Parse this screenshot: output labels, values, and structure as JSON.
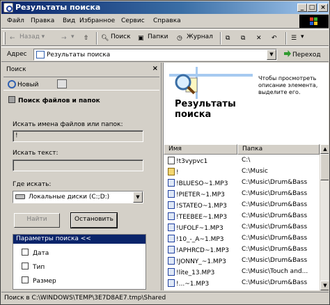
{
  "window": {
    "title": "Результаты поиска"
  },
  "menu": [
    "Файл",
    "Правка",
    "Вид",
    "Избранное",
    "Сервис",
    "Справка"
  ],
  "toolbar": {
    "back": "Назад",
    "search": "Поиск",
    "folders": "Папки",
    "history": "Журнал"
  },
  "address": {
    "label": "Адрес",
    "value": "Результаты поиска",
    "go": "Переход"
  },
  "search_pane": {
    "title": "Поиск",
    "new": "Новый",
    "heading": "Поиск файлов и папок",
    "names_label": "Искать имена файлов или папок:",
    "names_value": "!",
    "text_label": "Искать текст:",
    "text_value": "",
    "where_label": "Где искать:",
    "where_value": "Локальные диски (C:;D:)",
    "find_button": "Найти",
    "stop_button": "Остановить",
    "params_header": "Параметры поиска <<",
    "options": [
      "Дата",
      "Тип",
      "Размер"
    ]
  },
  "results": {
    "title_line1": "Результаты",
    "title_line2": "поиска",
    "hint": "Чтобы просмотреть описание элемента, выделите его.",
    "col_name": "Имя",
    "col_folder": "Папка",
    "rows": [
      {
        "name": "!t3vypvc1",
        "folder": "C:\\",
        "icon": "file"
      },
      {
        "name": "!",
        "folder": "C:\\Music",
        "icon": "folder"
      },
      {
        "name": "!BLUESO~1.MP3",
        "folder": "C:\\Music\\Drum&Bass",
        "icon": "audio"
      },
      {
        "name": "!PIETER~1.MP3",
        "folder": "C:\\Music\\Drum&Bass",
        "icon": "audio"
      },
      {
        "name": "!STATEO~1.MP3",
        "folder": "C:\\Music\\Drum&Bass",
        "icon": "audio"
      },
      {
        "name": "!TEEBEE~1.MP3",
        "folder": "C:\\Music\\Drum&Bass",
        "icon": "audio"
      },
      {
        "name": "!UFOLF~1.MP3",
        "folder": "C:\\Music\\Drum&Bass",
        "icon": "audio"
      },
      {
        "name": "!10_-_A~1.MP3",
        "folder": "C:\\Music\\Drum&Bass",
        "icon": "audio"
      },
      {
        "name": "!APHRCD~1.MP3",
        "folder": "C:\\Music\\Drum&Bass",
        "icon": "audio"
      },
      {
        "name": "!JONNY_~1.MP3",
        "folder": "C:\\Music\\Drum&Bass",
        "icon": "audio"
      },
      {
        "name": "!lite_13.MP3",
        "folder": "C:\\Music\\Touch and...",
        "icon": "audio"
      },
      {
        "name": "!...~1.MP3",
        "folder": "C:\\Music\\Drum&Bass",
        "icon": "audio"
      }
    ]
  },
  "status": {
    "text": "Поиск в C:\\WINDOWS\\TEMP\\3E7D8AE7.tmp\\Shared"
  }
}
